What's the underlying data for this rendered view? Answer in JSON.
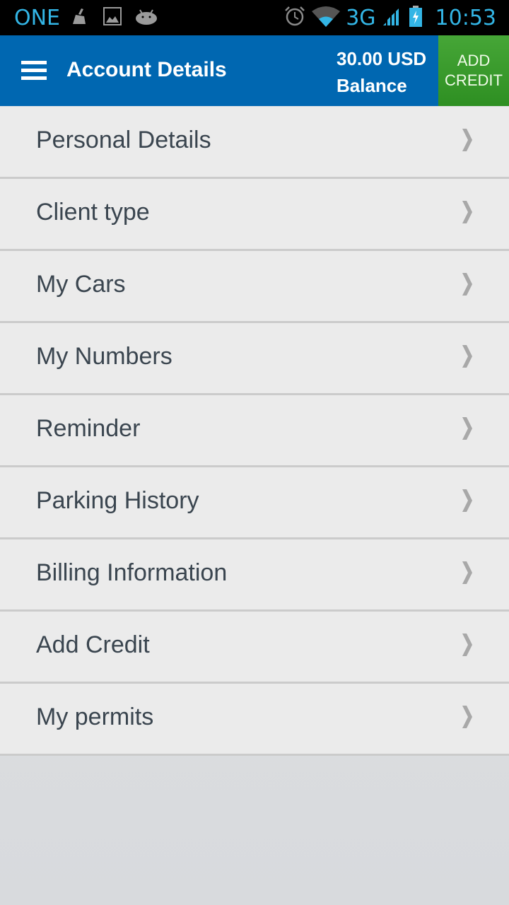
{
  "status_bar": {
    "carrier": "ONE",
    "network": "3G",
    "time": "10:53",
    "left_icons": [
      "broom-icon",
      "image-icon",
      "android-icon"
    ],
    "right_icons": [
      "alarm-icon",
      "wifi-icon",
      "signal-icon",
      "battery-charging-icon"
    ]
  },
  "action_bar": {
    "menu_icon": "hamburger-menu-icon",
    "title": "Account Details",
    "balance_amount": "30.00 USD",
    "balance_label": "Balance",
    "add_credit_line1": "ADD",
    "add_credit_line2": "CREDIT",
    "colors": {
      "bar": "#0067b1",
      "add_credit": "#3a9a2c"
    }
  },
  "menu": {
    "items": [
      {
        "label": "Personal Details"
      },
      {
        "label": "Client type"
      },
      {
        "label": "My Cars"
      },
      {
        "label": "My Numbers"
      },
      {
        "label": "Reminder"
      },
      {
        "label": "Parking History"
      },
      {
        "label": "Billing Information"
      },
      {
        "label": "Add Credit"
      },
      {
        "label": "My permits"
      }
    ],
    "item_icon": "chevron-right-icon"
  }
}
